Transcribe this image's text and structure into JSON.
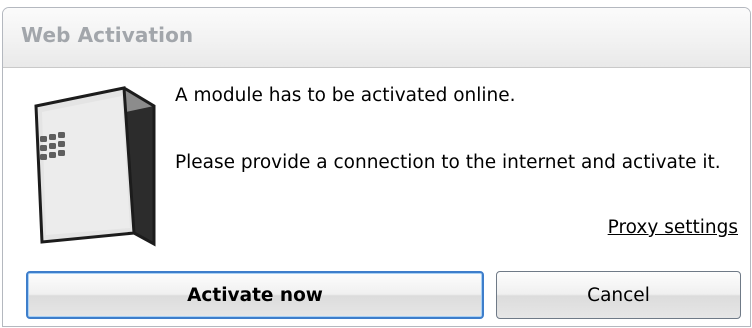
{
  "window": {
    "title": "Web Activation"
  },
  "message": {
    "line1": "A module has to be activated online.",
    "line2": "Please provide a connection to the internet and activate it."
  },
  "links": {
    "proxy_settings": "Proxy settings"
  },
  "buttons": {
    "activate_label": "Activate now",
    "cancel_label": "Cancel"
  },
  "icons": {
    "module": "module-box-icon"
  },
  "colors": {
    "primary_button_border": "#3e7ecb",
    "title_text": "#a2a6ab"
  }
}
